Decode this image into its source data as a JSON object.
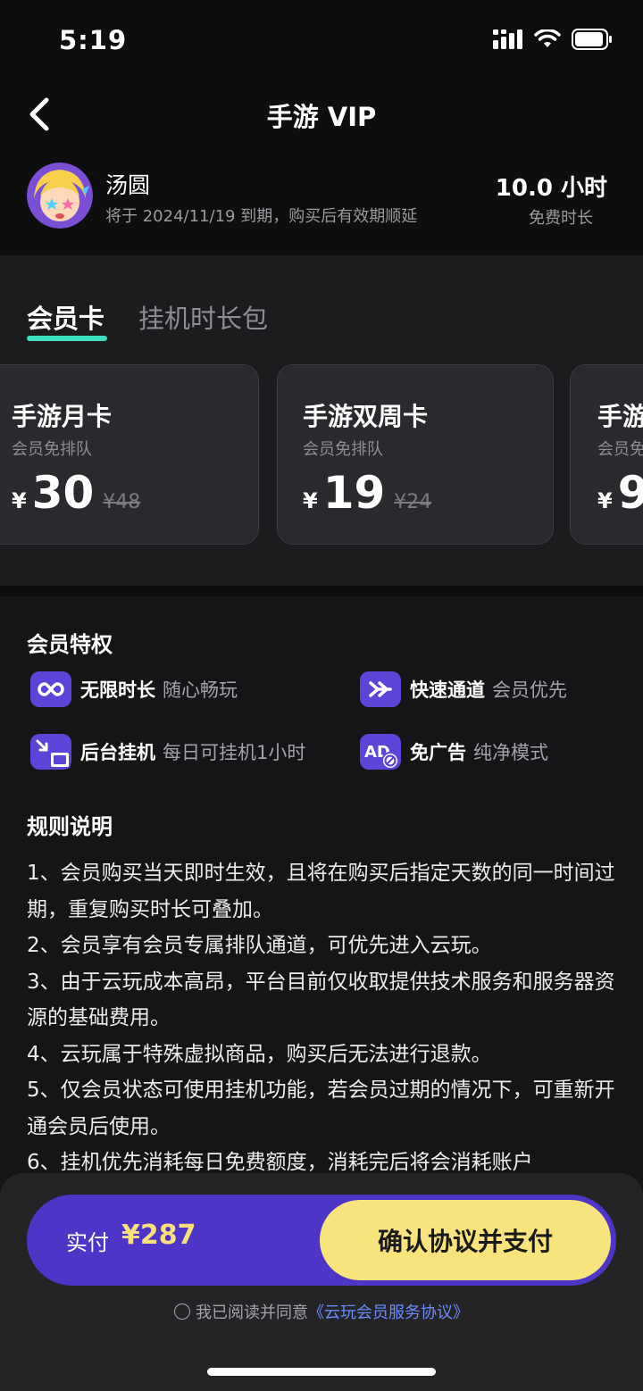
{
  "status_bar": {
    "time": "5:19"
  },
  "nav": {
    "title": "手游 VIP"
  },
  "user": {
    "name": "汤圆",
    "expiry_text": "将于 2024/11/19 到期，购买后有效期顺延",
    "free_hours": "10.0 小时",
    "free_hours_label": "免费时长"
  },
  "tabs": [
    {
      "label": "会员卡",
      "active": true
    },
    {
      "label": "挂机时长包",
      "active": false
    }
  ],
  "cards": [
    {
      "name": "手游月卡",
      "sub": "会员免排队",
      "currency": "¥",
      "price": "30",
      "original": "¥48"
    },
    {
      "name": "手游双周卡",
      "sub": "会员免排队",
      "currency": "¥",
      "price": "19",
      "original": "¥24"
    },
    {
      "name": "手游",
      "sub": "会员免",
      "currency": "¥",
      "price": "9",
      "original": ""
    }
  ],
  "privileges": {
    "title": "会员特权",
    "items": [
      {
        "icon": "infinity-icon",
        "name": "无限时长",
        "desc": "随心畅玩"
      },
      {
        "icon": "fast-forward-icon",
        "name": "快速通道",
        "desc": "会员优先"
      },
      {
        "icon": "background-run-icon",
        "name": "后台挂机",
        "desc": "每日可挂机1小时"
      },
      {
        "icon": "no-ads-icon",
        "name": "免广告",
        "desc": "纯净模式"
      }
    ]
  },
  "rules": {
    "title": "规则说明",
    "lines": [
      "1、会员购买当天即时生效，且将在购买后指定天数的同一时间过期，重复购买时长可叠加。",
      "2、会员享有会员专属排队通道，可优先进入云玩。",
      "3、由于云玩成本高昂，平台目前仅收取提供技术服务和服务器资源的基础费用。",
      "4、云玩属于特殊虚拟商品，购买后无法进行退款。",
      "5、仅会员状态可使用挂机功能，若会员过期的情况下，可重新开通会员后使用。",
      "6、挂机优先消耗每日免费额度，消耗完后将会消耗账户"
    ]
  },
  "payment": {
    "label": "实付",
    "amount": "¥287",
    "button": "确认协议并支付",
    "agree_text": "我已阅读并同意",
    "agreement_link": "《云玩会员服务协议》"
  },
  "colors": {
    "accent_purple": "#4f35c7",
    "accent_yellow": "#f8e37d",
    "tab_underline": "#3ee0c1"
  }
}
